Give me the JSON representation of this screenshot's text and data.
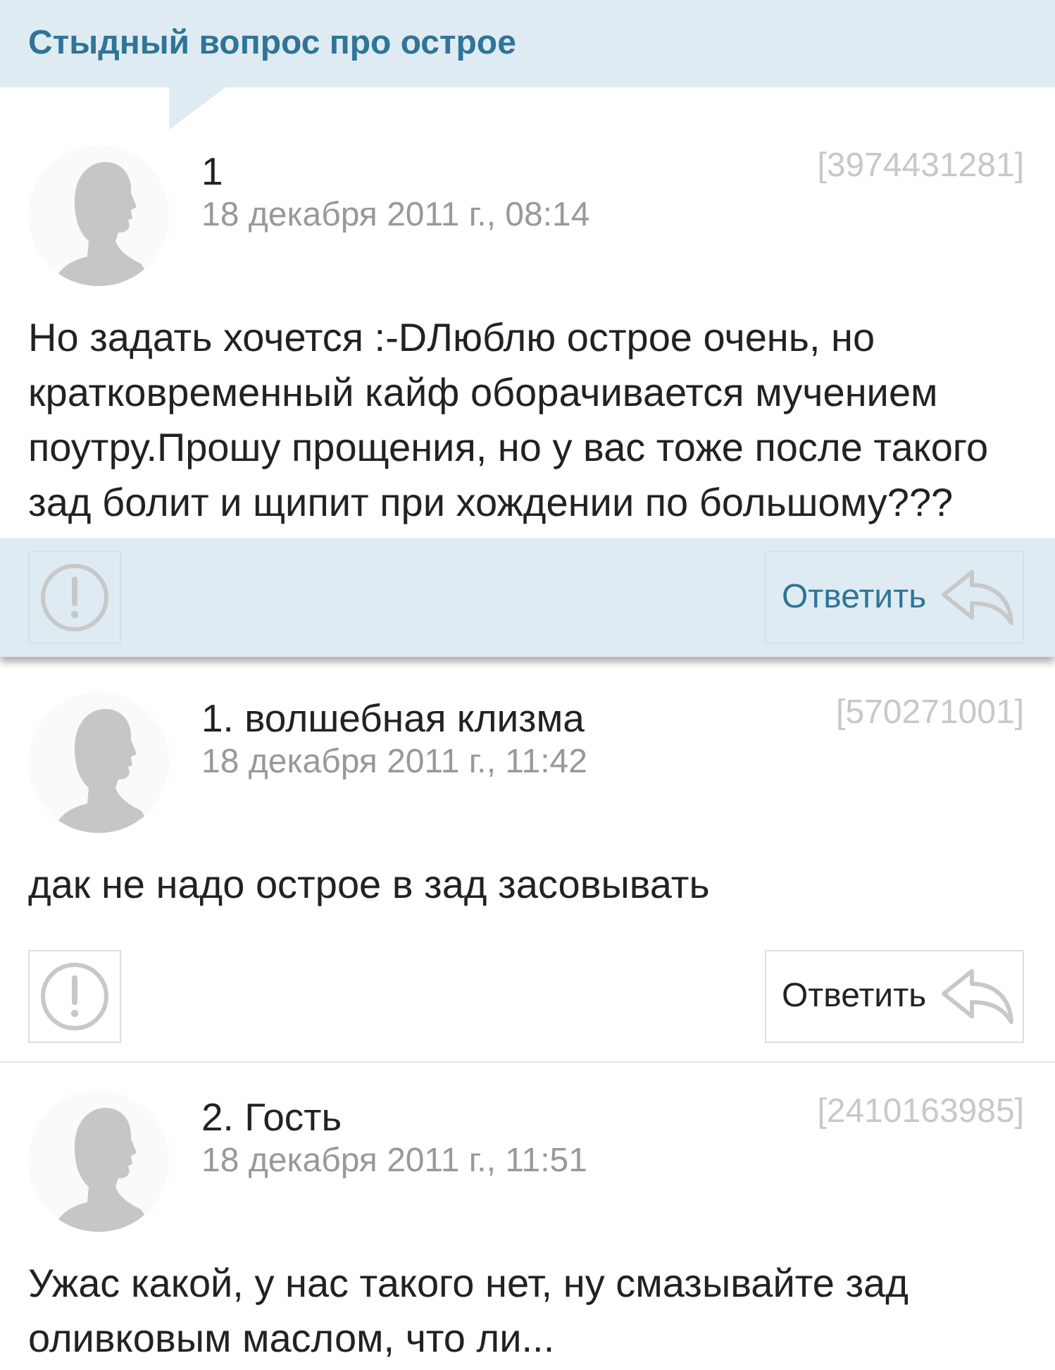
{
  "header": {
    "title": "Стыдный вопрос про острое"
  },
  "question": {
    "author": "1",
    "date": "18 декабря 2011 г., 08:14",
    "id": "[3974431281]",
    "text": "Но задать хочется :-DЛюблю острое очень, но кратковременный кайф оборачивается мучением поутру.Прошу прощения, но у вас тоже после такого зад болит и щипит при хождении по большому???",
    "reply_label": "Ответить"
  },
  "comments": [
    {
      "author": "1. волшебная клизма",
      "date": "18 декабря 2011 г., 11:42",
      "id": "[570271001]",
      "text": "дак не надо острое в зад засовывать",
      "reply_label": "Ответить"
    },
    {
      "author": "2. Гость",
      "date": "18 декабря 2011 г., 11:51",
      "id": "[2410163985]",
      "text": "Ужас какой, у нас такого нет, ну смазывайте зад оливковым маслом, что ли..."
    }
  ]
}
